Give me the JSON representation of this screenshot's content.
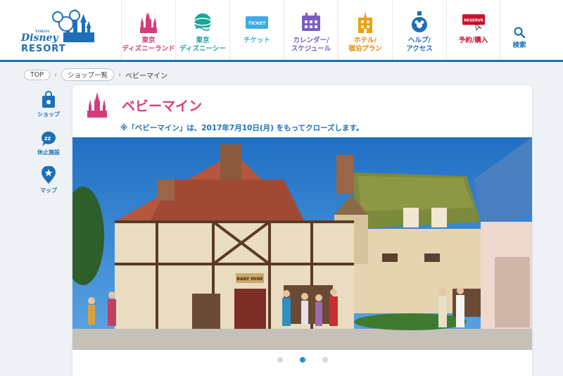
{
  "header": {
    "logo_small": "TOKYO",
    "logo_main": "Disney",
    "logo_resort": "RESORT",
    "nav": [
      {
        "label": "東京\nディズニーランド",
        "icon": "castle-icon",
        "color": "pink"
      },
      {
        "label": "東京\nディズニーシー",
        "icon": "globe-icon",
        "color": "blue"
      },
      {
        "label": "チケット",
        "icon": "ticket-icon",
        "color": "blue",
        "badge": "TICKET"
      },
      {
        "label": "カレンダー/\nスケジュール",
        "icon": "calendar-icon",
        "color": "blue"
      },
      {
        "label": "ホテル/\n宿泊プラン",
        "icon": "hotel-icon",
        "color": "blue"
      },
      {
        "label": "ヘルプ/\nアクセス",
        "icon": "help-icon",
        "color": "blue"
      },
      {
        "label": "予約/購入",
        "icon": "reserve-icon",
        "color": "red",
        "badge": "RESERVE"
      }
    ],
    "search_label": "検索"
  },
  "breadcrumb": {
    "items": [
      "TOP",
      "ショップ一覧"
    ],
    "current": "ベビーマイン"
  },
  "sidenav": [
    {
      "label": "ショップ",
      "icon": "shopping-bag-icon"
    },
    {
      "label": "休止施設",
      "icon": "sleep-icon"
    },
    {
      "label": "マップ",
      "icon": "map-pin-icon"
    }
  ],
  "main": {
    "title": "ベビーマイン",
    "notice": "※「ベビーマイン」は、2017年7月10日(月) をもってクローズします。",
    "shop_sign": "BABY MINE",
    "carousel_count": 3,
    "carousel_active": 2
  },
  "colors": {
    "brand_blue": "#1e6fb8",
    "pink": "#d63c7a",
    "red": "#c8102e",
    "dot_active": "#1e90d8"
  }
}
